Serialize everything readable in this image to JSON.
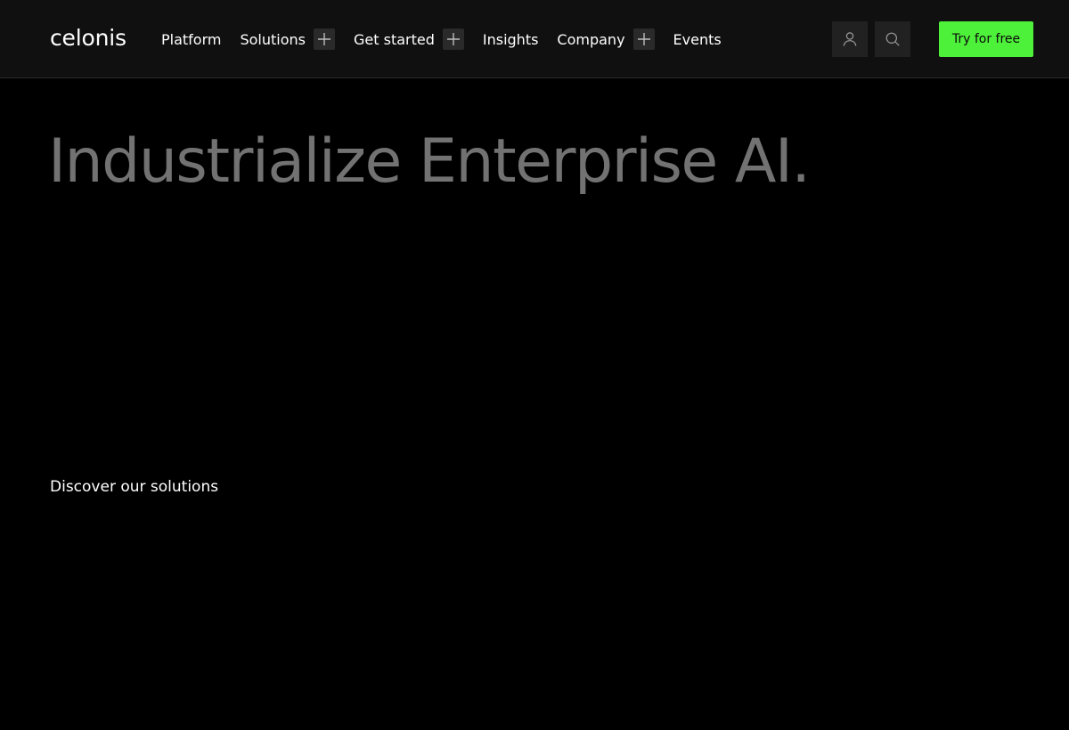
{
  "header": {
    "logo_text": "celonis",
    "nav": [
      {
        "label": "Platform",
        "expandable": false
      },
      {
        "label": "Solutions",
        "expandable": true
      },
      {
        "label": "Get started",
        "expandable": true
      },
      {
        "label": "Insights",
        "expandable": false
      },
      {
        "label": "Company",
        "expandable": true
      },
      {
        "label": "Events",
        "expandable": false
      }
    ],
    "account_icon": "user-icon",
    "search_icon": "search-icon",
    "cta_label": "Try for free"
  },
  "hero": {
    "title": "Industrialize Enterprise AI.",
    "discover_link": "Discover our solutions"
  },
  "colors": {
    "background": "#000000",
    "header_background": "#101010",
    "accent": "#4ef13a",
    "title_gray": "#727272"
  }
}
